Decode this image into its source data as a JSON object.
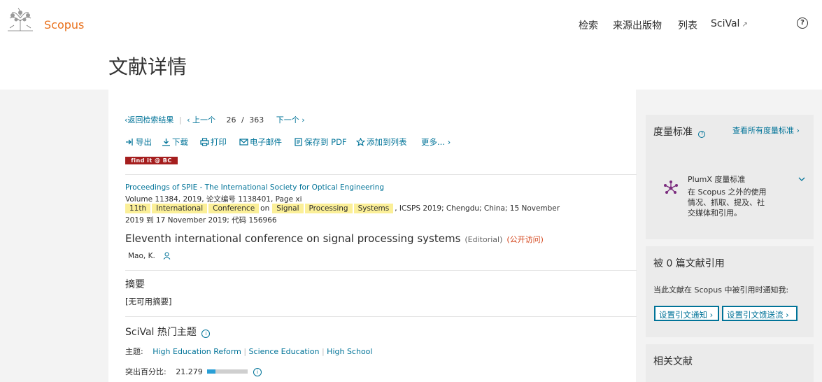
{
  "header": {
    "brand": "Scopus",
    "nav": [
      "检索",
      "来源出版物",
      "列表",
      "SciVal"
    ],
    "ext_glyph": "↗",
    "help_glyph": "?"
  },
  "page_title": "文献详情",
  "pager": {
    "back": "返回检索结果",
    "prev": "上一个",
    "current": "26",
    "slash": "/",
    "total": "363",
    "next": "下一个"
  },
  "toolbar": {
    "export": "导出",
    "download": "下载",
    "print": "打印",
    "email": "电子邮件",
    "save_pdf": "保存到 PDF",
    "add_list": "添加到列表",
    "more": "更多..."
  },
  "findit": "find it @ BC",
  "source": {
    "journal": "Proceedings of SPIE - The International Society for Optical Engineering",
    "volume_line": "Volume 11384, 2019, 论文编号 1138401, Page xi",
    "conf_words": [
      "11th",
      "International",
      "Conference"
    ],
    "conf_on": "on",
    "conf_words2": [
      "Signal",
      "Processing",
      "Systems"
    ],
    "conf_rest": ", ICSPS 2019; Chengdu; China; 15 November",
    "date_line": "2019 到 17 November 2019; 代码 156966"
  },
  "doc": {
    "title": "Eleventh international conference on signal processing systems",
    "type": "(Editorial)",
    "open_access": "(公开访问)",
    "author": "Mao, K."
  },
  "abstract": {
    "heading": "摘要",
    "text": "[无可用摘要]"
  },
  "scival": {
    "heading": "SciVal 热门主题",
    "topic_label": "主题:",
    "topics": [
      "High Education Reform",
      "Science Education",
      "High School"
    ],
    "percentile_label": "突出百分比:",
    "percentile": "21.279",
    "percentile_fraction": 0.21279
  },
  "metrics": {
    "title": "度量标准",
    "view_all": "查看所有度量标准",
    "plumx_title": "PlumX 度量标准",
    "plumx_desc": [
      "在 Scopus 之外的使用",
      "情况、抓取、提及、社",
      "交媒体和引用。"
    ]
  },
  "cited": {
    "title": "被 0 篇文献引用",
    "notify": "当此文献在 Scopus 中被引用时通知我:",
    "btn_alert": "设置引文通知",
    "btn_feed": "设置引文馈送流"
  },
  "related": {
    "title": "相关文献"
  },
  "colors": {
    "brand": "#e9711c",
    "link": "#007398",
    "open_access": "#d4481f",
    "highlight": "#fbef98",
    "plumx": "#7b2c7e"
  }
}
